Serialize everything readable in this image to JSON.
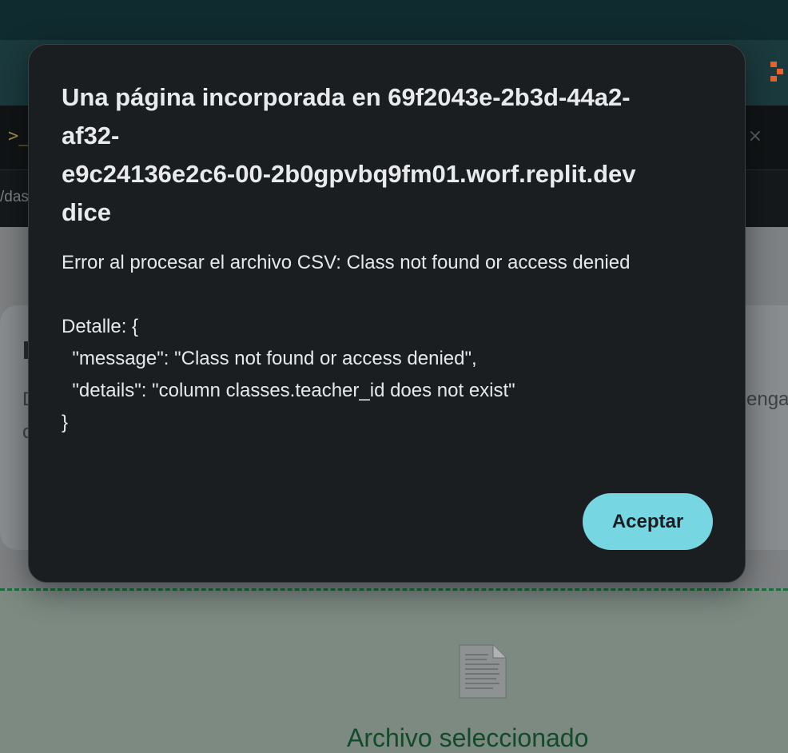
{
  "background": {
    "terminal_glyph": ">_",
    "close_glyph": "×",
    "url_fragment": "/das",
    "card_text_left_1": "D",
    "card_text_left_2": "c",
    "card_text_right": "enga",
    "file_status": "Archivo seleccionado",
    "colors": {
      "top_strip": "#102b2f",
      "browser_bar": "#1b3a3e",
      "replit_orange": "#e8632c",
      "dropzone_border": "#1b6e3c",
      "file_status_text": "#134a2a"
    }
  },
  "dialog": {
    "title_lines": [
      "Una página incorporada en 69f2043e-2b3d-44a2-",
      "af32-",
      "e9c24136e2c6-00-2b0gpvbq9fm01.worf.replit.dev",
      "dice"
    ],
    "message_lines": [
      "Error al procesar el archivo CSV: Class not found or access denied",
      "",
      "Detalle: {",
      "  \"message\": \"Class not found or access denied\",",
      "  \"details\": \"column classes.teacher_id does not exist\"",
      "}"
    ],
    "ok_label": "Aceptar",
    "colors": {
      "background": "#1b1e21",
      "button": "#76d6e2",
      "text": "#e6e8ea"
    }
  }
}
